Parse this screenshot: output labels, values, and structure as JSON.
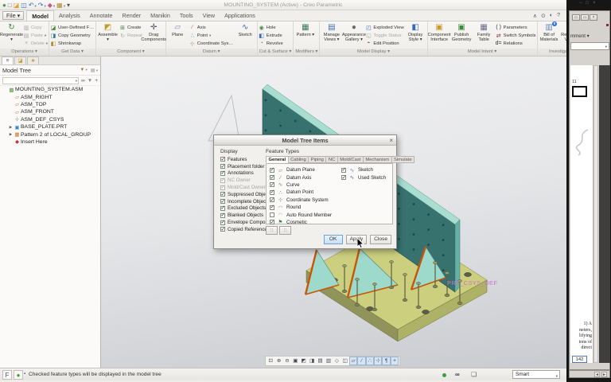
{
  "window": {
    "title": "MOUNTING_SYSTEM (Active) - Creo Parametric"
  },
  "quick_access": [
    {
      "name": "app-logo-icon",
      "glyph": "●",
      "color": "#3f9b44"
    },
    {
      "name": "new-file-icon",
      "glyph": "□",
      "color": "#667788"
    },
    {
      "name": "open-file-icon",
      "glyph": "◪",
      "color": "#d8a33a"
    },
    {
      "name": "save-icon",
      "glyph": "◫",
      "color": "#3a6ab0"
    },
    {
      "name": "undo-icon",
      "glyph": "↶",
      "color": "#2a6ab0",
      "menu": true
    },
    {
      "name": "redo-icon",
      "glyph": "↷",
      "color": "#2a6ab0",
      "menu": true
    },
    {
      "name": "model-display-icon",
      "glyph": "◆",
      "color": "#c05a8a",
      "menu": true
    },
    {
      "name": "window-icon",
      "glyph": "▦",
      "color": "#b08a3a",
      "menu": true
    },
    {
      "name": "customize-icon",
      "glyph": "▾",
      "color": "#555555"
    }
  ],
  "tabs": {
    "file": "File",
    "items": [
      {
        "label": "Model",
        "active": true
      },
      {
        "label": "Analysis"
      },
      {
        "label": "Annotate"
      },
      {
        "label": "Render"
      },
      {
        "label": "Manikin"
      },
      {
        "label": "Tools"
      },
      {
        "label": "View"
      },
      {
        "label": "Applications"
      }
    ],
    "right_icons": [
      {
        "name": "minimize-ribbon-icon",
        "glyph": "∧"
      },
      {
        "name": "command-search-icon",
        "glyph": "⊙"
      },
      {
        "name": "status-circle-icon",
        "glyph": "◐"
      },
      {
        "name": "help-icon",
        "glyph": "?"
      }
    ]
  },
  "ribbon": {
    "groups": [
      {
        "label": "Operations",
        "menu": true,
        "cols": [
          {
            "type": "big",
            "label": "Regenerate",
            "menu": true,
            "glyph": "↻",
            "color": "#3a8a3a"
          },
          {
            "type": "stack",
            "buttons": [
              {
                "label": "Copy",
                "glyph": "▥",
                "color": "#9a9a9a",
                "disabled": true
              },
              {
                "label": "Paste",
                "glyph": "▤",
                "color": "#9a9a9a",
                "disabled": true,
                "menu": true
              },
              {
                "label": "Delete",
                "glyph": "×",
                "color": "#9a9a9a",
                "disabled": true,
                "menu": true
              }
            ]
          }
        ]
      },
      {
        "label": "Get Data",
        "menu": true,
        "cols": [
          {
            "type": "stack",
            "buttons": [
              {
                "label": "User-Defined Feature",
                "glyph": "◪",
                "color": "#4a8a3a"
              },
              {
                "label": "Copy Geometry",
                "glyph": "◨",
                "color": "#3a7a8a"
              },
              {
                "label": "Shrinkwrap",
                "glyph": "◧",
                "color": "#b08a3a"
              }
            ]
          }
        ]
      },
      {
        "label": "Component",
        "menu": true,
        "cols": [
          {
            "type": "big",
            "label": "Assemble",
            "menu": true,
            "glyph": "◩",
            "color": "#c89a28"
          },
          {
            "type": "stack",
            "buttons": [
              {
                "label": "Create",
                "glyph": "⊞",
                "color": "#4a7a4a"
              },
              {
                "label": "Repeat",
                "glyph": "↻",
                "color": "#9a9a9a",
                "disabled": true
              }
            ]
          },
          {
            "type": "big",
            "label": "Drag Components",
            "glyph": "✛",
            "color": "#555566"
          }
        ]
      },
      {
        "label": "Datum",
        "menu": true,
        "cols": [
          {
            "type": "big",
            "label": "Plane",
            "glyph": "▱",
            "color": "#8a8aa8"
          },
          {
            "type": "stack",
            "buttons": [
              {
                "label": "Axis",
                "glyph": "∕",
                "color": "#b05a3a"
              },
              {
                "label": "Point",
                "glyph": "∴",
                "color": "#3a6ab0",
                "menu": true
              },
              {
                "label": "Coordinate System",
                "glyph": "⊹",
                "color": "#b07a3a"
              }
            ]
          },
          {
            "type": "big",
            "label": "Sketch",
            "glyph": "∿",
            "color": "#3a6ab0"
          }
        ]
      },
      {
        "label": "Cut & Surface",
        "menu": true,
        "cols": [
          {
            "type": "stack",
            "buttons": [
              {
                "label": "Hole",
                "glyph": "◉",
                "color": "#4a8a4a"
              },
              {
                "label": "Extrude",
                "glyph": "◧",
                "color": "#3a6ab0"
              },
              {
                "label": "Revolve",
                "glyph": "◔",
                "color": "#8a6a3a"
              }
            ]
          }
        ]
      },
      {
        "label": "Modifiers",
        "menu": true,
        "cols": [
          {
            "type": "big",
            "label": "Pattern",
            "menu": true,
            "glyph": "▦",
            "color": "#3a7a5a"
          }
        ]
      },
      {
        "label": "Model Display",
        "menu": true,
        "cols": [
          {
            "type": "big",
            "label": "Manage Views",
            "menu": true,
            "glyph": "▤",
            "color": "#3a6ab0"
          },
          {
            "type": "big",
            "label": "Appearance Gallery",
            "menu": true,
            "glyph": "●",
            "color": "#6a6a6a"
          },
          {
            "type": "stack",
            "buttons": [
              {
                "label": "Exploded View",
                "glyph": "◰",
                "color": "#3a6ab0"
              },
              {
                "label": "Toggle Status",
                "glyph": "◱",
                "color": "#9a9a9a",
                "disabled": true
              },
              {
                "label": "Edit Position",
                "glyph": "◓",
                "color": "#b06a2a"
              }
            ]
          },
          {
            "type": "big",
            "label": "Display Style",
            "menu": true,
            "glyph": "◧",
            "color": "#3a6ab0"
          }
        ]
      },
      {
        "label": "Model Intent",
        "menu": true,
        "cols": [
          {
            "type": "big",
            "label": "Component Interface",
            "glyph": "▣",
            "color": "#c89a28"
          },
          {
            "type": "big",
            "label": "Publish Geometry",
            "glyph": "▣",
            "color": "#3a8a3a"
          },
          {
            "type": "big",
            "label": "Family Table",
            "glyph": "▦",
            "color": "#6a6a8a"
          },
          {
            "type": "stack",
            "buttons": [
              {
                "label": "Parameters",
                "glyph": "( )",
                "color": "#333333"
              },
              {
                "label": "Switch Symbols",
                "glyph": "⇄",
                "color": "#8a3a3a"
              },
              {
                "label": "Relations",
                "glyph": "d=",
                "color": "#333333"
              }
            ]
          }
        ]
      },
      {
        "label": "Investigate",
        "cols": [
          {
            "type": "big",
            "label": "Bill of Materials",
            "glyph": "▥",
            "color": "#6a8ab0",
            "badge": "0"
          },
          {
            "type": "big",
            "label": "Reference Viewer",
            "glyph": "∞",
            "color": "#6a6a6a",
            "badge": "0"
          }
        ]
      }
    ]
  },
  "navigator": {
    "tabs": [
      {
        "name": "nav-model-tree-tab",
        "glyph": "≡",
        "color": "#556677",
        "active": true
      },
      {
        "name": "nav-folder-browser-tab",
        "glyph": "◪",
        "color": "#c89a28"
      },
      {
        "name": "nav-favorites-tab",
        "glyph": "★",
        "color": "#c89a28"
      }
    ],
    "header": {
      "title": "Model Tree"
    },
    "header_icons": [
      {
        "name": "tree-filters-icon",
        "glyph": "▼",
        "color": "#997a3a",
        "menu": true
      },
      {
        "name": "tree-columns-icon",
        "glyph": "▤",
        "color": "#888888",
        "menu": true
      }
    ],
    "search_icons": [
      {
        "name": "find-in-tree-icon",
        "glyph": "∞",
        "color": "#444444"
      },
      {
        "name": "tree-filter-icon",
        "glyph": "▼",
        "color": "#888888"
      },
      {
        "name": "tree-expand-icon",
        "glyph": "+",
        "color": "#555555"
      }
    ],
    "items": [
      {
        "label": "MOUNTING_SYSTEM.ASM",
        "icon": "assembly-icon",
        "glyph": "▩",
        "color": "#5a9a3a",
        "indent": 0
      },
      {
        "label": "ASM_RIGHT",
        "icon": "datum-plane-icon",
        "glyph": "▱",
        "color": "#b07a3a",
        "indent": 1
      },
      {
        "label": "ASM_TOP",
        "icon": "datum-plane-icon",
        "glyph": "▱",
        "color": "#b07a3a",
        "indent": 1
      },
      {
        "label": "ASM_FRONT",
        "icon": "datum-plane-icon",
        "glyph": "▱",
        "color": "#b07a3a",
        "indent": 1
      },
      {
        "label": "ASM_DEF_CSYS",
        "icon": "csys-icon",
        "glyph": "⊹",
        "color": "#3a8a7a",
        "indent": 1
      },
      {
        "label": "BASE_PLATE.PRT",
        "icon": "part-icon",
        "glyph": "▣",
        "color": "#3a87c8",
        "indent": 1,
        "expander": true
      },
      {
        "label": "Pattern 2 of LOCAL_GROUP",
        "icon": "pattern-icon",
        "glyph": "▦",
        "color": "#c87a28",
        "indent": 1,
        "expander": true
      },
      {
        "label": "Insert Here",
        "icon": "insert-marker-icon",
        "glyph": "◆",
        "color": "#cc3333",
        "indent": 1
      }
    ]
  },
  "graphics": {
    "csys_label": "PRT_CSYS_DEF",
    "csys_label_color": "#cf6fcf",
    "toolbar": [
      {
        "name": "refit-icon",
        "glyph": "⊡"
      },
      {
        "name": "zoom-in-icon",
        "glyph": "⊕"
      },
      {
        "name": "zoom-out-icon",
        "glyph": "⊖"
      },
      {
        "name": "repaint-icon",
        "glyph": "▣"
      },
      {
        "name": "shade-icon",
        "glyph": "◩"
      },
      {
        "name": "display-style-icon",
        "glyph": "◨"
      },
      {
        "name": "saved-views-icon",
        "glyph": "▤"
      },
      {
        "name": "view-manager-icon",
        "glyph": "▥"
      },
      {
        "name": "perspective-icon",
        "glyph": "◇"
      },
      {
        "name": "section-icon",
        "glyph": "◫"
      },
      {
        "name": "datum-planes-toggle-icon",
        "glyph": "▱",
        "active": true
      },
      {
        "name": "datum-axes-toggle-icon",
        "glyph": "∕",
        "active": true
      },
      {
        "name": "datum-points-toggle-icon",
        "glyph": "∴",
        "active": true
      },
      {
        "name": "datum-csys-toggle-icon",
        "glyph": "⊹",
        "active": true
      },
      {
        "name": "annotations-toggle-icon",
        "glyph": "¶",
        "active": true
      },
      {
        "name": "spin-center-toggle-icon",
        "glyph": "+",
        "active": true
      }
    ]
  },
  "dialog": {
    "title": "Model Tree Items",
    "display": {
      "label": "Display",
      "items": [
        {
          "label": "Features",
          "checked": true
        },
        {
          "label": "Placement folder",
          "checked": true
        },
        {
          "label": "Annotations",
          "checked": true
        },
        {
          "label": "NC Owner",
          "checked": true,
          "disabled": true
        },
        {
          "label": "Mold/Cast Owner",
          "checked": true,
          "disabled": true
        },
        {
          "label": "Suppressed Objects",
          "checked": true
        },
        {
          "label": "Incomplete Objects",
          "checked": true
        },
        {
          "label": "Excluded Objects",
          "checked": true
        },
        {
          "label": "Blanked Objects",
          "checked": true
        },
        {
          "label": "Envelope Components",
          "checked": true
        },
        {
          "label": "Copied References",
          "checked": true
        }
      ]
    },
    "feature_types": {
      "label": "Feature Types",
      "tabs": [
        "General",
        "Cabling",
        "Piping",
        "NC",
        "Mold/Cast",
        "Mechanism",
        "Simulate"
      ],
      "active_tab": "General",
      "col1": [
        {
          "label": "Datum Plane",
          "checked": true,
          "icon": "datum-plane-icon",
          "glyph": "▱",
          "color": "#b07a3a"
        },
        {
          "label": "Datum Axis",
          "checked": true,
          "icon": "datum-axis-icon",
          "glyph": "∕",
          "color": "#b05a3a"
        },
        {
          "label": "Curve",
          "checked": true,
          "icon": "curve-icon",
          "glyph": "∿",
          "color": "#a06a28"
        },
        {
          "label": "Datum Point",
          "checked": true,
          "icon": "datum-point-icon",
          "glyph": "∴",
          "color": "#3a6ab0"
        },
        {
          "label": "Coordinate System",
          "checked": true,
          "icon": "csys-icon",
          "glyph": "⊹",
          "color": "#3a8a7a"
        },
        {
          "label": "Round",
          "checked": true,
          "icon": "round-icon",
          "glyph": "◠",
          "color": "#888888"
        },
        {
          "label": "Auto Round Member",
          "checked": false,
          "icon": "auto-round-icon",
          "glyph": "◠",
          "color": "#aaaaaa"
        },
        {
          "label": "Cosmetic",
          "checked": true,
          "icon": "cosmetic-icon",
          "glyph": "⚑",
          "color": "#3a8a3a"
        }
      ],
      "col2": [
        {
          "label": "Sketch",
          "checked": true,
          "icon": "sketch-icon",
          "glyph": "∿",
          "color": "#3a6ab0"
        },
        {
          "label": "Used Sketch",
          "checked": true,
          "icon": "used-sketch-icon",
          "glyph": "∿",
          "color": "#2a4a8a"
        }
      ],
      "picker_glyph": "∷"
    },
    "buttons": {
      "ok": "OK",
      "apply": "Apply",
      "close": "Close"
    }
  },
  "statusbar": {
    "left_icons": [
      {
        "name": "selection-filter-icon",
        "glyph": "F",
        "color": "#445577"
      },
      {
        "name": "accessibility-icon",
        "glyph": "●",
        "color": "#3f9b44"
      }
    ],
    "message": "Checked feature types will be displayed in the model tree",
    "smart": "Smart"
  },
  "side_window": {
    "controls": [
      {
        "name": "side-minimize-icon",
        "glyph": "−"
      },
      {
        "name": "side-maximize-icon",
        "glyph": "□"
      },
      {
        "name": "side-close-icon",
        "glyph": "×"
      }
    ],
    "buttons": [
      {
        "name": "doc-restore-icon",
        "glyph": "▭"
      },
      {
        "name": "doc-minimize-icon",
        "glyph": "▭"
      },
      {
        "name": "doc-close-icon",
        "glyph": "×"
      }
    ],
    "toolbar_text": "mment ▾",
    "page_top": "11",
    "fragments": [
      "1)  A",
      "neters,",
      "lifying",
      "ions of",
      "direct"
    ],
    "page_no": "142"
  }
}
